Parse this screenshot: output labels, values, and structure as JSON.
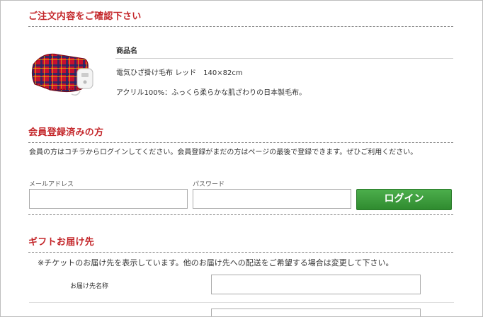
{
  "order_section": {
    "title": "ご注文内容をご確認下さい",
    "product_header": "商品名",
    "product_name": "電気ひざ掛け毛布 レッド　140×82cm",
    "product_desc": "アクリル100%：ふっくら柔らかな肌ざわりの日本製毛布。"
  },
  "member_section": {
    "title": "会員登録済みの方",
    "description": "会員の方はコチラからログインしてください。会員登録がまだの方はページの最後で登録できます。ぜひご利用ください。",
    "email_label": "メールアドレス",
    "email_value": "",
    "password_label": "パスワード",
    "password_value": "",
    "login_button": "ログイン"
  },
  "gift_section": {
    "title": "ギフトお届け先",
    "note": "※チケットのお届け先を表示しています。他のお届け先への配送をご希望する場合は変更して下さい。",
    "recipient_label": "お届け先名称",
    "recipient_value": ""
  },
  "colors": {
    "accent": "#c4272b",
    "button": "#3a9b3a"
  }
}
